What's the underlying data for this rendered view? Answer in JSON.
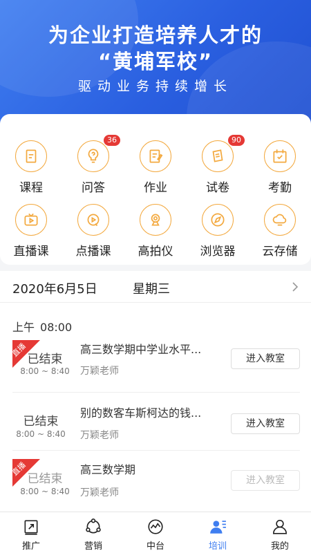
{
  "banner": {
    "line1": "为企业打造培养人才的",
    "line2": "“黄埔军校”",
    "line3": "驱动业务持续增长"
  },
  "grid": [
    {
      "label": "课程",
      "icon": "course-icon"
    },
    {
      "label": "问答",
      "icon": "qa-icon",
      "badge": "36"
    },
    {
      "label": "作业",
      "icon": "homework-icon"
    },
    {
      "label": "试卷",
      "icon": "exam-icon",
      "badge": "90"
    },
    {
      "label": "考勤",
      "icon": "attendance-icon"
    },
    {
      "label": "直播课",
      "icon": "live-tv-icon"
    },
    {
      "label": "点播课",
      "icon": "vod-icon"
    },
    {
      "label": "高拍仪",
      "icon": "camera-scanner-icon"
    },
    {
      "label": "浏览器",
      "icon": "compass-icon"
    },
    {
      "label": "云存储",
      "icon": "cloud-storage-icon"
    }
  ],
  "schedule": {
    "date": "2020年6月5日",
    "weekday": "星期三",
    "period_label": "上午",
    "period_time": "08:00",
    "classes": [
      {
        "live_tag": "直播",
        "status": "已结束",
        "time": "8:00 ~ 8:40",
        "title": "高三数学期中学业水平...",
        "teacher": "万颖老师",
        "button": "进入教室"
      },
      {
        "status": "已结束",
        "time": "8:00 ~ 8:40",
        "title": "别的数客车斯柯达的钱...",
        "teacher": "万颖老师",
        "button": "进入教室"
      },
      {
        "live_tag": "直播",
        "status": "已结束",
        "time": "8:00 ~ 8:40",
        "title": "高三数学期",
        "teacher": "万颖老师",
        "button": "进入教室"
      }
    ]
  },
  "tabs": [
    {
      "label": "推广",
      "icon": "promote-icon"
    },
    {
      "label": "营销",
      "icon": "marketing-icon"
    },
    {
      "label": "中台",
      "icon": "platform-icon"
    },
    {
      "label": "培训",
      "icon": "training-icon",
      "active": true
    },
    {
      "label": "我的",
      "icon": "profile-icon"
    }
  ],
  "colors": {
    "primary": "#3f7ef0",
    "accent_orange": "#f3a93f",
    "badge_red": "#e53935"
  }
}
